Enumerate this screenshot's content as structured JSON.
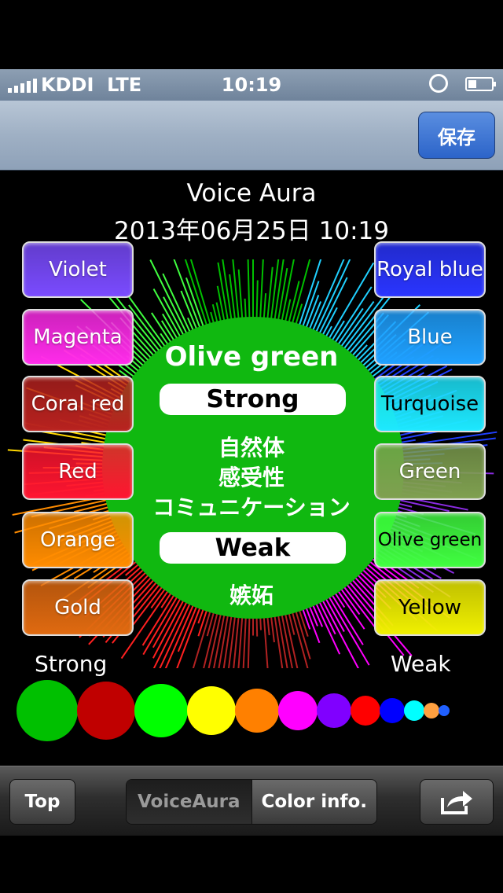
{
  "status_bar": {
    "carrier": "KDDI",
    "network": "LTE",
    "time": "10:19"
  },
  "nav": {
    "save_label": "保存"
  },
  "header": {
    "app_title": "Voice Aura",
    "datetime": "2013年06月25日 10:19"
  },
  "left_buttons": [
    {
      "label": "Violet",
      "color": "#7a4bff"
    },
    {
      "label": "Magenta",
      "color": "#ff2bea"
    },
    {
      "label": "Coral red",
      "color": "#b8221f"
    },
    {
      "label": "Red",
      "color": "#ff1530"
    },
    {
      "label": "Orange",
      "color": "#ff8c00"
    },
    {
      "label": "Gold",
      "color": "#e06a10"
    }
  ],
  "right_buttons": [
    {
      "label": "Royal blue",
      "color": "#2a35ff"
    },
    {
      "label": "Blue",
      "color": "#1fa0ff"
    },
    {
      "label": "Turquoise",
      "color": "#1de8ff"
    },
    {
      "label": "Green",
      "color": "#7fa050"
    },
    {
      "label": "Olive green",
      "color": "#40ff40"
    },
    {
      "label": "Yellow",
      "color": "#f0f000"
    }
  ],
  "aura": {
    "color_name": "Olive green",
    "strong_label": "Strong",
    "strong_traits": [
      "自然体",
      "感受性",
      "コミュニケーション"
    ],
    "weak_label": "Weak",
    "weak_traits": [
      "嫉妬"
    ],
    "color": "#10b810"
  },
  "legend": {
    "strong": "Strong",
    "weak": "Weak"
  },
  "strength_dots": [
    {
      "color": "#00c000"
    },
    {
      "color": "#c00000"
    },
    {
      "color": "#00ff00"
    },
    {
      "color": "#ffff00"
    },
    {
      "color": "#ff8000"
    },
    {
      "color": "#ff00ff"
    },
    {
      "color": "#8000ff"
    },
    {
      "color": "#ff0000"
    },
    {
      "color": "#0000ff"
    },
    {
      "color": "#00ffff"
    },
    {
      "color": "#ffa040"
    },
    {
      "color": "#2060ff"
    }
  ],
  "tab_bar": {
    "top_label": "Top",
    "voiceaura_label": "VoiceAura",
    "colorinfo_label": "Color info."
  }
}
